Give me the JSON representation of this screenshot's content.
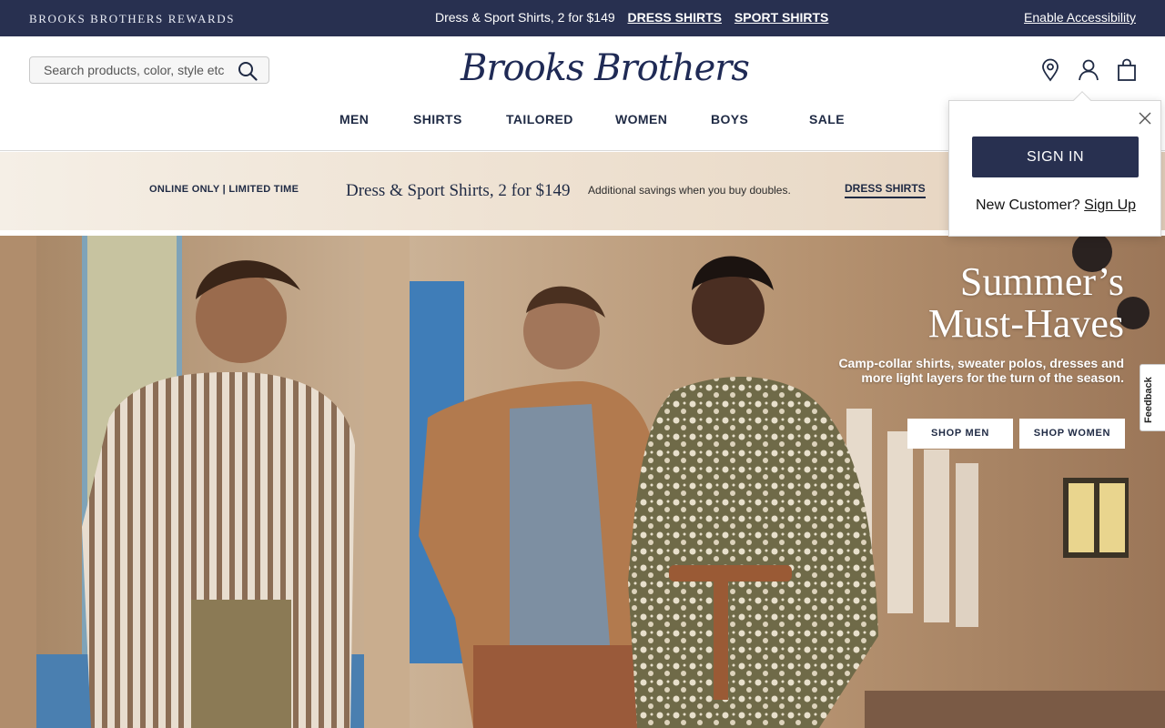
{
  "topbar": {
    "rewards": "BROOKS BROTHERS REWARDS",
    "promo_text": "Dress & Sport Shirts, 2 for $149",
    "promo_link_1": "DRESS SHIRTS",
    "promo_link_2": "SPORT SHIRTS",
    "accessibility": "Enable Accessibility"
  },
  "header": {
    "search_placeholder": "Search products, color, style etc",
    "logo": "Brooks Brothers",
    "icons": [
      "location-pin-icon",
      "account-icon",
      "shopping-bag-icon"
    ]
  },
  "nav": {
    "items": [
      "MEN",
      "SHIRTS",
      "TAILORED",
      "WOMEN",
      "BOYS",
      "SALE"
    ]
  },
  "promo_band": {
    "eyebrow": "ONLINE ONLY | LIMITED TIME",
    "headline": "Dress & Sport Shirts, 2 for $149",
    "subtext": "Additional savings when you buy doubles.",
    "link": "DRESS SHIRTS"
  },
  "hero": {
    "title_line_1": "Summer’s",
    "title_line_2": "Must-Haves",
    "description": "Camp-collar shirts, sweater polos, dresses and more light layers for the turn of the season.",
    "cta_men": "SHOP MEN",
    "cta_women": "SHOP WOMEN"
  },
  "feedback": "Feedback",
  "signin_popover": {
    "button": "SIGN IN",
    "new_customer": "New Customer?",
    "sign_up": "Sign Up"
  },
  "colors": {
    "navy": "#283050",
    "band": "#efe3d4",
    "hero_wall": "#b89674"
  }
}
